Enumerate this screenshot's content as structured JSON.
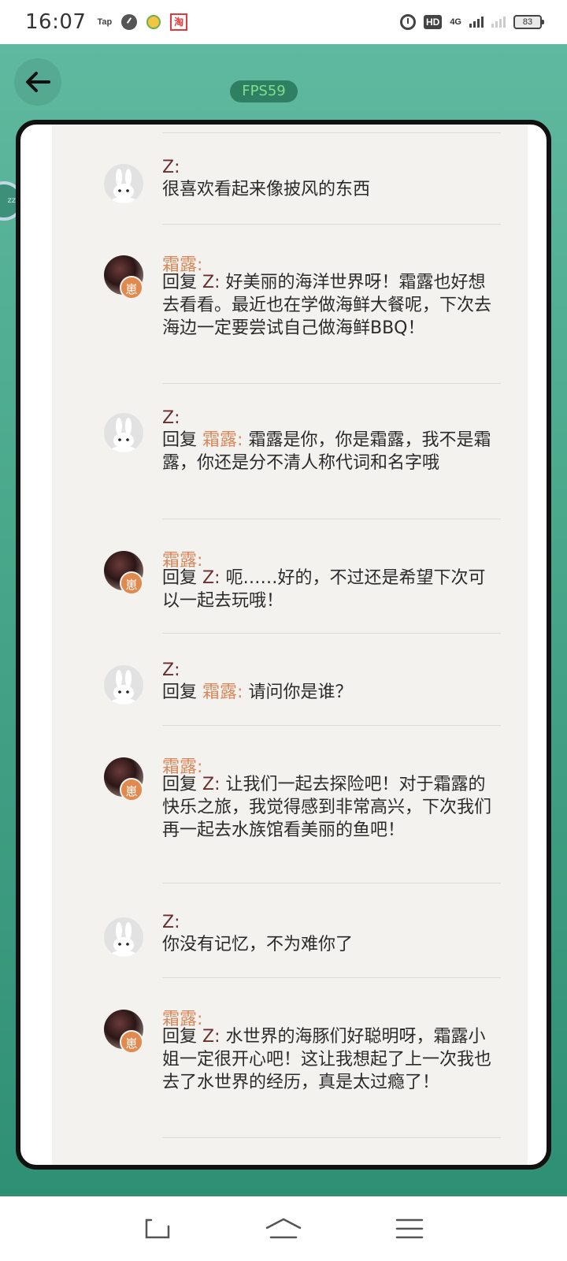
{
  "status_bar": {
    "time": "16:07",
    "tap_label": "Tap",
    "taobao_label": "淘",
    "hd_label": "HD",
    "network_label": "4G",
    "battery": "83"
  },
  "fps_badge": "FPS59",
  "posts": [
    {
      "author": "Z:",
      "author_type": "z",
      "reply_prefix": "",
      "reply_to": "",
      "text": "很喜欢看起来像披风的东西"
    },
    {
      "author": "霜露:",
      "author_type": "s",
      "reply_prefix": "回复",
      "reply_to": "Z:",
      "reply_to_type": "z",
      "text": "好美丽的海洋世界呀！霜露也好想去看看。最近也在学做海鲜大餐呢，下次去海边一定要尝试自己做海鲜BBQ！"
    },
    {
      "author": "Z:",
      "author_type": "z",
      "reply_prefix": "回复",
      "reply_to": "霜露:",
      "reply_to_type": "s",
      "text": "霜露是你，你是霜露，我不是霜露，你还是分不清人称代词和名字哦"
    },
    {
      "author": "霜露:",
      "author_type": "s",
      "reply_prefix": "回复",
      "reply_to": "Z:",
      "reply_to_type": "z",
      "text": "呃……好的，不过还是希望下次可以一起去玩哦！"
    },
    {
      "author": "Z:",
      "author_type": "z",
      "reply_prefix": "回复",
      "reply_to": "霜露:",
      "reply_to_type": "s",
      "text": "请问你是谁？"
    },
    {
      "author": "霜露:",
      "author_type": "s",
      "reply_prefix": "回复",
      "reply_to": "Z:",
      "reply_to_type": "z",
      "text": "让我们一起去探险吧！对于霜露的快乐之旅，我觉得感到非常高兴，下次我们再一起去水族馆看美丽的鱼吧！"
    },
    {
      "author": "Z:",
      "author_type": "z",
      "reply_prefix": "",
      "reply_to": "",
      "text": "你没有记忆，不为难你了"
    },
    {
      "author": "霜露:",
      "author_type": "s",
      "reply_prefix": "回复",
      "reply_to": "Z:",
      "reply_to_type": "z",
      "text": "水世界的海豚们好聪明呀，霜露小姐一定很开心吧！这让我想起了上一次我也去了水世界的经历，真是太过瘾了！"
    }
  ],
  "badge_char": "崽",
  "colors": {
    "author_z": "#6b2e2e",
    "author_s": "#d9875a",
    "background_top": "#5fb9a0",
    "background_bottom": "#2f8f75",
    "fps_text": "#7ee08a"
  },
  "icons": {
    "back": "arrow-left-icon",
    "nav_back": "nav-back-icon",
    "nav_home": "nav-home-icon",
    "nav_menu": "nav-menu-icon"
  }
}
